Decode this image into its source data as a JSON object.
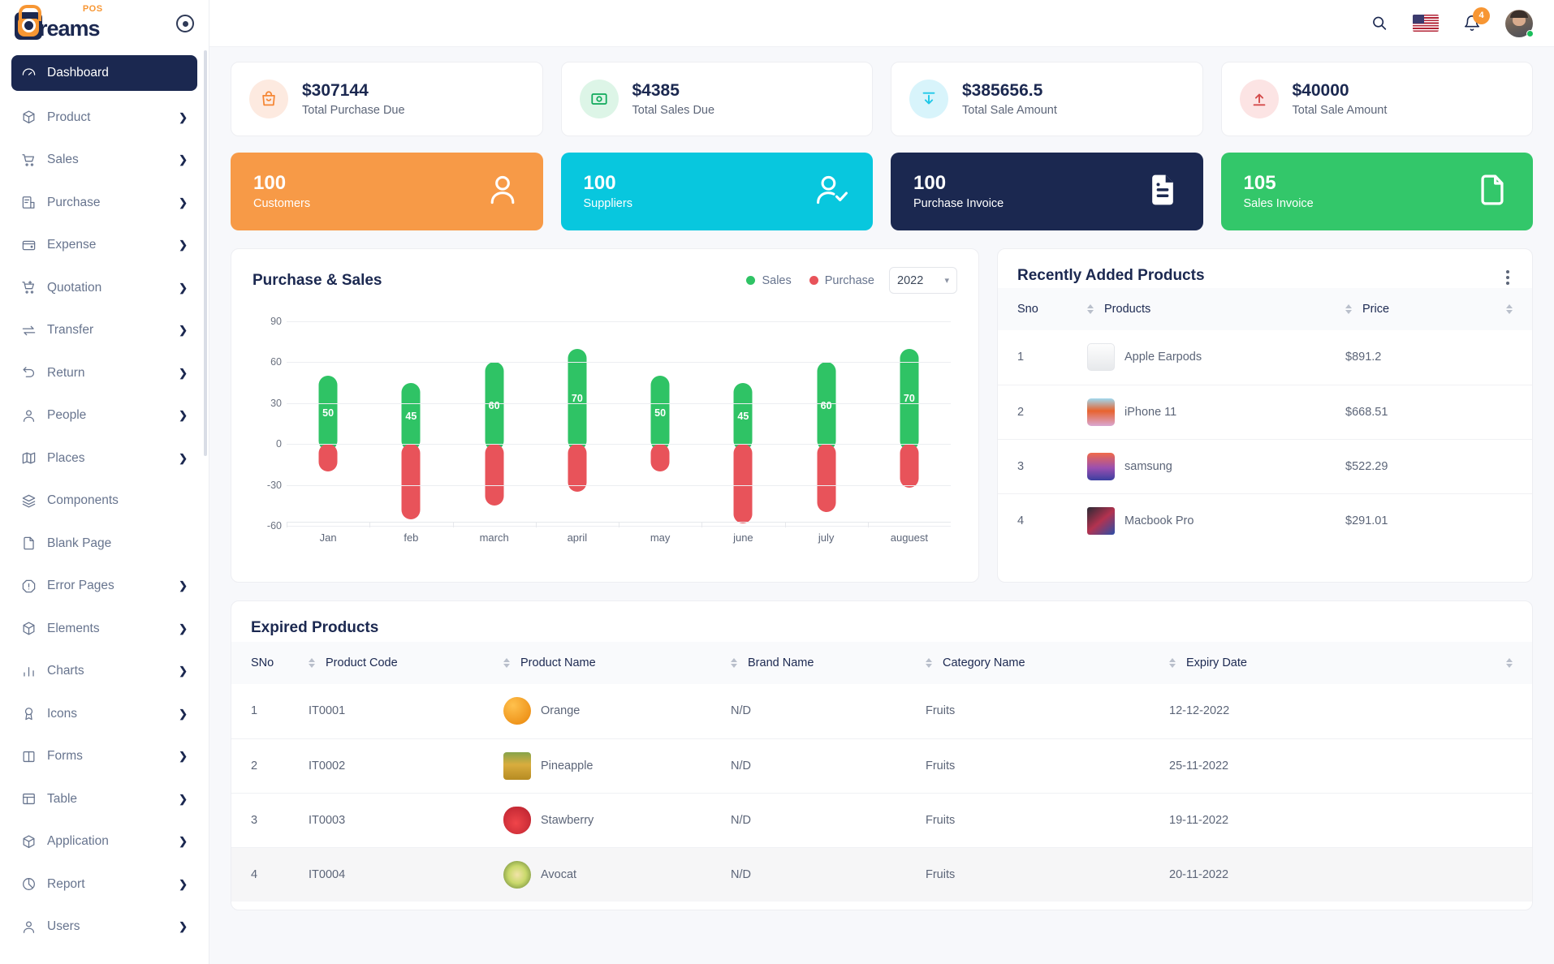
{
  "brand": {
    "name": "reams",
    "sup": "POS",
    "toggle_icon": "circle-dot-icon"
  },
  "topbar": {
    "search_icon": "search-icon",
    "flag_icon": "us-flag-icon",
    "bell_icon": "bell-icon",
    "notification_count": "4",
    "avatar_icon": "user-avatar"
  },
  "sidebar": {
    "items": [
      {
        "label": "Dashboard",
        "icon": "speedometer-icon",
        "active": true,
        "caret": false
      },
      {
        "label": "Product",
        "icon": "box-icon",
        "active": false,
        "caret": true
      },
      {
        "label": "Sales",
        "icon": "cart-icon",
        "active": false,
        "caret": true
      },
      {
        "label": "Purchase",
        "icon": "invoice-icon",
        "active": false,
        "caret": true
      },
      {
        "label": "Expense",
        "icon": "wallet-icon",
        "active": false,
        "caret": true
      },
      {
        "label": "Quotation",
        "icon": "quote-cart-icon",
        "active": false,
        "caret": true
      },
      {
        "label": "Transfer",
        "icon": "transfer-arrows-icon",
        "active": false,
        "caret": true
      },
      {
        "label": "Return",
        "icon": "return-arrow-icon",
        "active": false,
        "caret": true
      },
      {
        "label": "People",
        "icon": "person-icon",
        "active": false,
        "caret": true
      },
      {
        "label": "Places",
        "icon": "map-icon",
        "active": false,
        "caret": true
      },
      {
        "label": "Components",
        "icon": "layers-icon",
        "active": false,
        "caret": false
      },
      {
        "label": "Blank Page",
        "icon": "page-icon",
        "active": false,
        "caret": false
      },
      {
        "label": "Error Pages",
        "icon": "alert-octagon-icon",
        "active": false,
        "caret": true
      },
      {
        "label": "Elements",
        "icon": "cube-icon",
        "active": false,
        "caret": true
      },
      {
        "label": "Charts",
        "icon": "bar-chart-icon",
        "active": false,
        "caret": true
      },
      {
        "label": "Icons",
        "icon": "award-icon",
        "active": false,
        "caret": true
      },
      {
        "label": "Forms",
        "icon": "columns-icon",
        "active": false,
        "caret": true
      },
      {
        "label": "Table",
        "icon": "table-icon",
        "active": false,
        "caret": true
      },
      {
        "label": "Application",
        "icon": "box-icon",
        "active": false,
        "caret": true
      },
      {
        "label": "Report",
        "icon": "pie-chart-icon",
        "active": false,
        "caret": true
      },
      {
        "label": "Users",
        "icon": "person-icon",
        "active": false,
        "caret": true
      }
    ]
  },
  "stats": [
    {
      "value": "$307144",
      "label": "Total Purchase Due",
      "icon": "purchase-bag-icon",
      "color": "#f58634",
      "bg": "#fdeae0"
    },
    {
      "value": "$4385",
      "label": "Total Sales Due",
      "icon": "cash-icon",
      "color": "#0ea95a",
      "bg": "#ddf5e7"
    },
    {
      "value": "$385656.5",
      "label": "Total Sale Amount",
      "icon": "download-arrow-icon",
      "color": "#1ec8e8",
      "bg": "#d8f4fb"
    },
    {
      "value": "$40000",
      "label": "Total Sale Amount",
      "icon": "upload-arrow-icon",
      "color": "#d44b4b",
      "bg": "#fce4e4"
    }
  ],
  "counters": [
    {
      "number": "100",
      "label": "Customers",
      "icon": "user-icon",
      "bg": "#f79a47"
    },
    {
      "number": "100",
      "label": "Suppliers",
      "icon": "user-check-icon",
      "bg": "#08c7de"
    },
    {
      "number": "100",
      "label": "Purchase Invoice",
      "icon": "invoice-doc-icon",
      "bg": "#1b2850"
    },
    {
      "number": "105",
      "label": "Sales Invoice",
      "icon": "file-icon",
      "bg": "#33c76a"
    }
  ],
  "chart_panel": {
    "title": "Purchase & Sales",
    "legend": [
      {
        "label": "Sales",
        "color": "#2fc365"
      },
      {
        "label": "Purchase",
        "color": "#e8535a"
      }
    ],
    "year_selected": "2022",
    "year_chevron": "chevron-down-icon"
  },
  "chart_data": {
    "type": "bar",
    "title": "Purchase & Sales",
    "categories": [
      "Jan",
      "feb",
      "march",
      "april",
      "may",
      "june",
      "july",
      "auguest"
    ],
    "series": [
      {
        "name": "Sales",
        "color": "#2fc365",
        "values": [
          50,
          45,
          60,
          70,
          50,
          45,
          60,
          70
        ]
      },
      {
        "name": "Purchase",
        "color": "#e8535a",
        "values": [
          -20,
          -55,
          -45,
          -35,
          -20,
          -58,
          -50,
          -32
        ]
      }
    ],
    "data_labels": [
      "50",
      "45",
      "60",
      "70",
      "50",
      "45",
      "60",
      "70"
    ],
    "ylabel": "",
    "xlabel": "",
    "ylim": [
      -60,
      90
    ],
    "yticks": [
      90,
      60,
      30,
      0,
      -30,
      -60
    ],
    "grid": true,
    "legend_position": "top-right",
    "stacked": true
  },
  "recent_panel": {
    "title": "Recently Added Products",
    "menu_icon": "kebab-menu-icon",
    "columns": [
      "Sno",
      "Products",
      "Price"
    ],
    "rows": [
      {
        "sno": "1",
        "product": "Apple Earpods",
        "price": "$891.2",
        "thumb": "earpods-thumb"
      },
      {
        "sno": "2",
        "product": "iPhone 11",
        "price": "$668.51",
        "thumb": "iphone-thumb"
      },
      {
        "sno": "3",
        "product": "samsung",
        "price": "$522.29",
        "thumb": "samsung-thumb"
      },
      {
        "sno": "4",
        "product": "Macbook Pro",
        "price": "$291.01",
        "thumb": "macbook-thumb"
      }
    ]
  },
  "expired_panel": {
    "title": "Expired Products",
    "columns": [
      "SNo",
      "Product Code",
      "Product Name",
      "Brand Name",
      "Category Name",
      "Expiry Date"
    ],
    "rows": [
      {
        "sno": "1",
        "code": "IT0001",
        "name": "Orange",
        "brand": "N/D",
        "category": "Fruits",
        "expiry": "12-12-2022",
        "thumb": "orange-thumb",
        "highlight": false
      },
      {
        "sno": "2",
        "code": "IT0002",
        "name": "Pineapple",
        "brand": "N/D",
        "category": "Fruits",
        "expiry": "25-11-2022",
        "thumb": "pineapple-thumb",
        "highlight": false
      },
      {
        "sno": "3",
        "code": "IT0003",
        "name": "Stawberry",
        "brand": "N/D",
        "category": "Fruits",
        "expiry": "19-11-2022",
        "thumb": "strawberry-thumb",
        "highlight": false
      },
      {
        "sno": "4",
        "code": "IT0004",
        "name": "Avocat",
        "brand": "N/D",
        "category": "Fruits",
        "expiry": "20-11-2022",
        "thumb": "avocado-thumb",
        "highlight": true
      }
    ]
  }
}
